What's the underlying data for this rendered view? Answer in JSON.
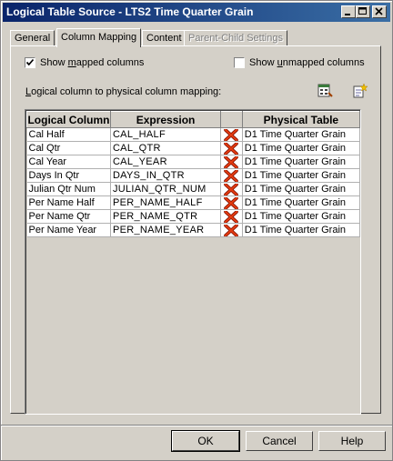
{
  "window": {
    "title": "Logical Table Source - LTS2 Time Quarter Grain"
  },
  "tabs": [
    {
      "label": "General"
    },
    {
      "label": "Column Mapping"
    },
    {
      "label": "Content"
    },
    {
      "label": "Parent-Child Settings"
    }
  ],
  "options": {
    "show_mapped": {
      "pre": "Show ",
      "mnemonic": "m",
      "post": "apped columns",
      "checked": true
    },
    "show_unmapped": {
      "pre": "Show ",
      "mnemonic": "u",
      "post": "nmapped columns",
      "checked": false
    }
  },
  "mapping_label": {
    "pre": "",
    "mnemonic": "L",
    "post": "ogical column to physical column mapping:"
  },
  "table": {
    "headers": [
      "Logical Column",
      "Expression",
      "",
      "Physical Table"
    ],
    "rows": [
      {
        "logical": "Cal Half",
        "expression": "CAL_HALF",
        "physical": "D1 Time Quarter Grain"
      },
      {
        "logical": "Cal Qtr",
        "expression": "CAL_QTR",
        "physical": "D1 Time Quarter Grain"
      },
      {
        "logical": "Cal Year",
        "expression": "CAL_YEAR",
        "physical": "D1 Time Quarter Grain"
      },
      {
        "logical": "Days In Qtr",
        "expression": "DAYS_IN_QTR",
        "physical": "D1 Time Quarter Grain"
      },
      {
        "logical": "Julian Qtr Num",
        "expression": "JULIAN_QTR_NUM",
        "physical": "D1 Time Quarter Grain"
      },
      {
        "logical": "Per Name Half",
        "expression": "PER_NAME_HALF",
        "physical": "D1 Time Quarter Grain"
      },
      {
        "logical": "Per Name Qtr",
        "expression": "PER_NAME_QTR",
        "physical": "D1 Time Quarter Grain"
      },
      {
        "logical": "Per Name Year",
        "expression": "PER_NAME_YEAR",
        "physical": "D1 Time Quarter Grain"
      }
    ]
  },
  "buttons": {
    "ok": "OK",
    "cancel": "Cancel",
    "help": "Help"
  },
  "icons": {
    "row_delete": "delete-x-icon",
    "edit_expression": "expression-builder-icon",
    "new_mapping": "new-mapping-icon"
  },
  "colors": {
    "title_bar_start": "#0a246a",
    "title_bar_end": "#3a6ea5",
    "delete_red": "#cc2200"
  }
}
